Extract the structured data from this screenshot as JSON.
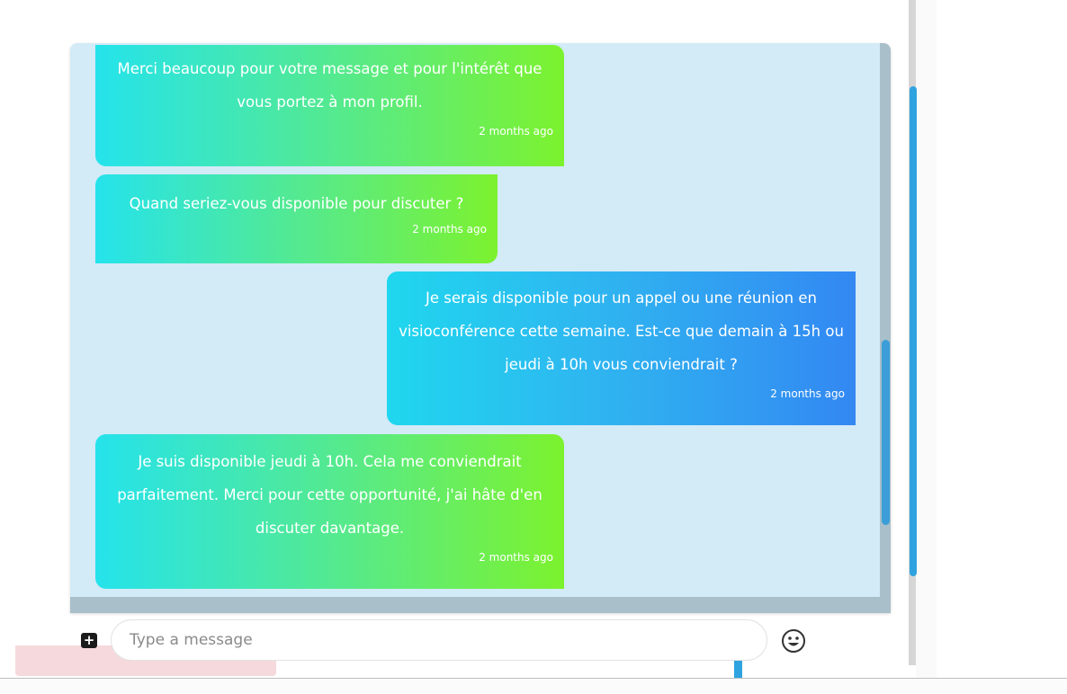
{
  "messages": [
    {
      "direction": "received",
      "text": "Merci beaucoup pour votre message et pour l'intérêt que vous portez à mon profil.",
      "time": "2 months ago"
    },
    {
      "direction": "received",
      "text": "Quand seriez-vous disponible pour discuter ?",
      "time": "2 months ago"
    },
    {
      "direction": "sent",
      "text": "Je serais disponible pour un appel ou une réunion en visioconférence cette semaine. Est-ce que demain à 15h ou jeudi à 10h vous conviendrait ?",
      "time": "2 months ago"
    },
    {
      "direction": "received",
      "text": "Je suis disponible jeudi à 10h. Cela me conviendrait parfaitement. Merci pour cette opportunité, j'ai hâte d'en discuter davantage.",
      "time": "2 months ago"
    }
  ],
  "composer": {
    "placeholder": "Type a message",
    "value": "",
    "attach_icon": "plus-square-icon",
    "emoji_icon": "smiley-icon"
  },
  "colors": {
    "received_gradient": [
      "#25e3ec",
      "#7cf22e"
    ],
    "sent_gradient": [
      "#1fd7ee",
      "#3388f2"
    ],
    "chat_background": "#d3eaf7"
  }
}
